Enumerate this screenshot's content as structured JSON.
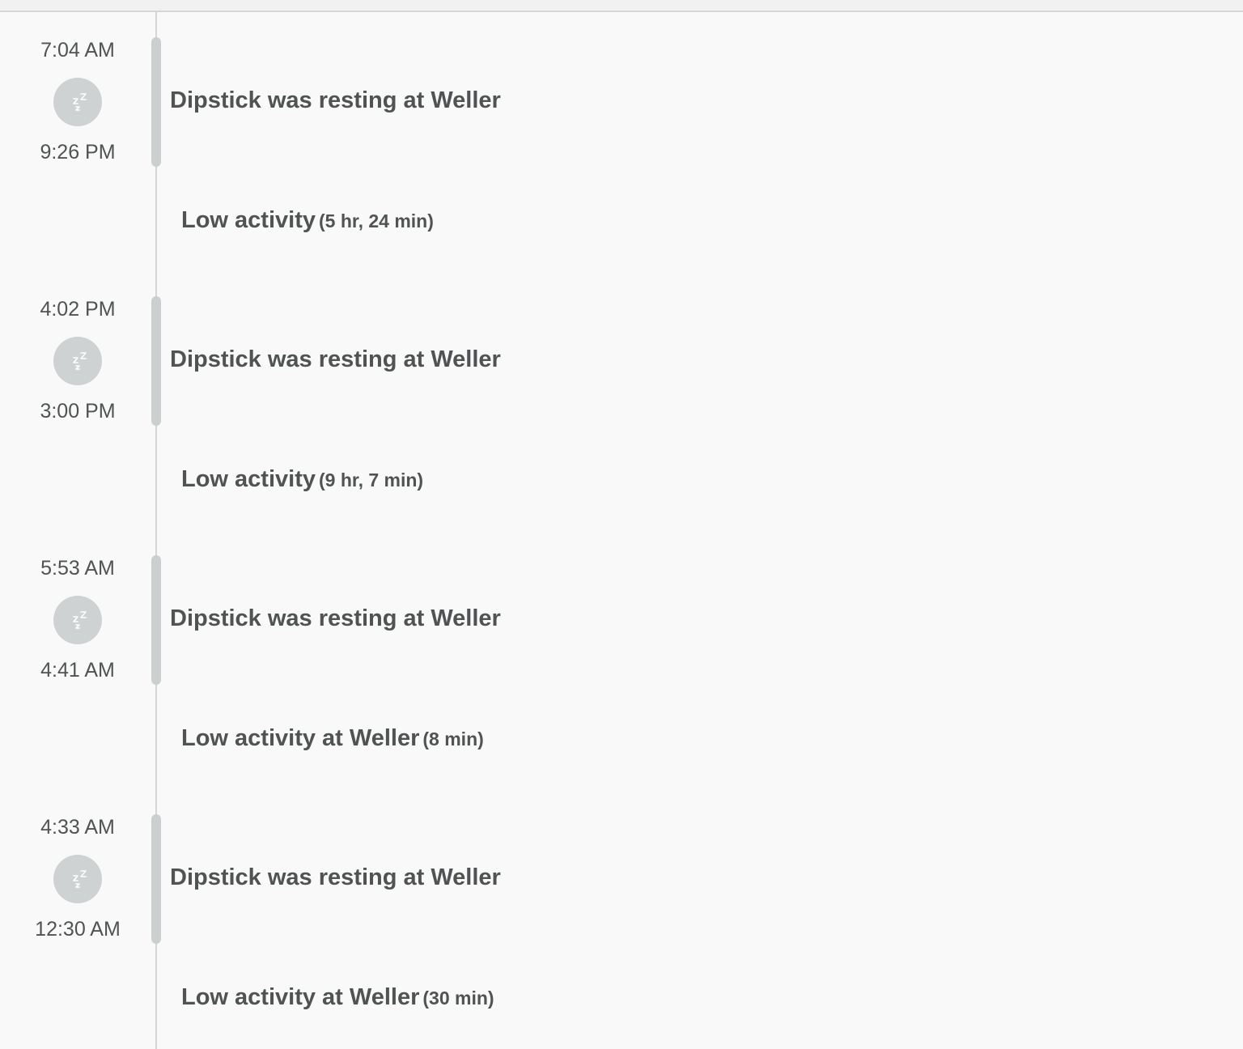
{
  "timeline": {
    "stays": [
      {
        "start": "7:04 AM",
        "end": "9:26 PM",
        "label": "Dipstick was resting at Weller",
        "icon": "sleep-icon"
      },
      {
        "start": "4:02 PM",
        "end": "3:00 PM",
        "label": "Dipstick was resting at Weller",
        "icon": "sleep-icon"
      },
      {
        "start": "5:53 AM",
        "end": "4:41 AM",
        "label": "Dipstick was resting at Weller",
        "icon": "sleep-icon"
      },
      {
        "start": "4:33 AM",
        "end": "12:30 AM",
        "label": "Dipstick was resting at Weller",
        "icon": "sleep-icon"
      }
    ],
    "gaps": [
      {
        "text": "Low activity",
        "duration": "(5 hr, 24 min)"
      },
      {
        "text": "Low activity",
        "duration": "(9 hr, 7 min)"
      },
      {
        "text": "Low activity at Weller",
        "duration": "(8 min)"
      },
      {
        "text": "Low activity at Weller",
        "duration": "(30 min)"
      }
    ]
  },
  "colors": {
    "background": "#f9f9f9",
    "text": "#4f5353",
    "bar": "#cbcfcf",
    "icon_bg": "#cfd2d2",
    "axis": "#d3d6d6"
  }
}
